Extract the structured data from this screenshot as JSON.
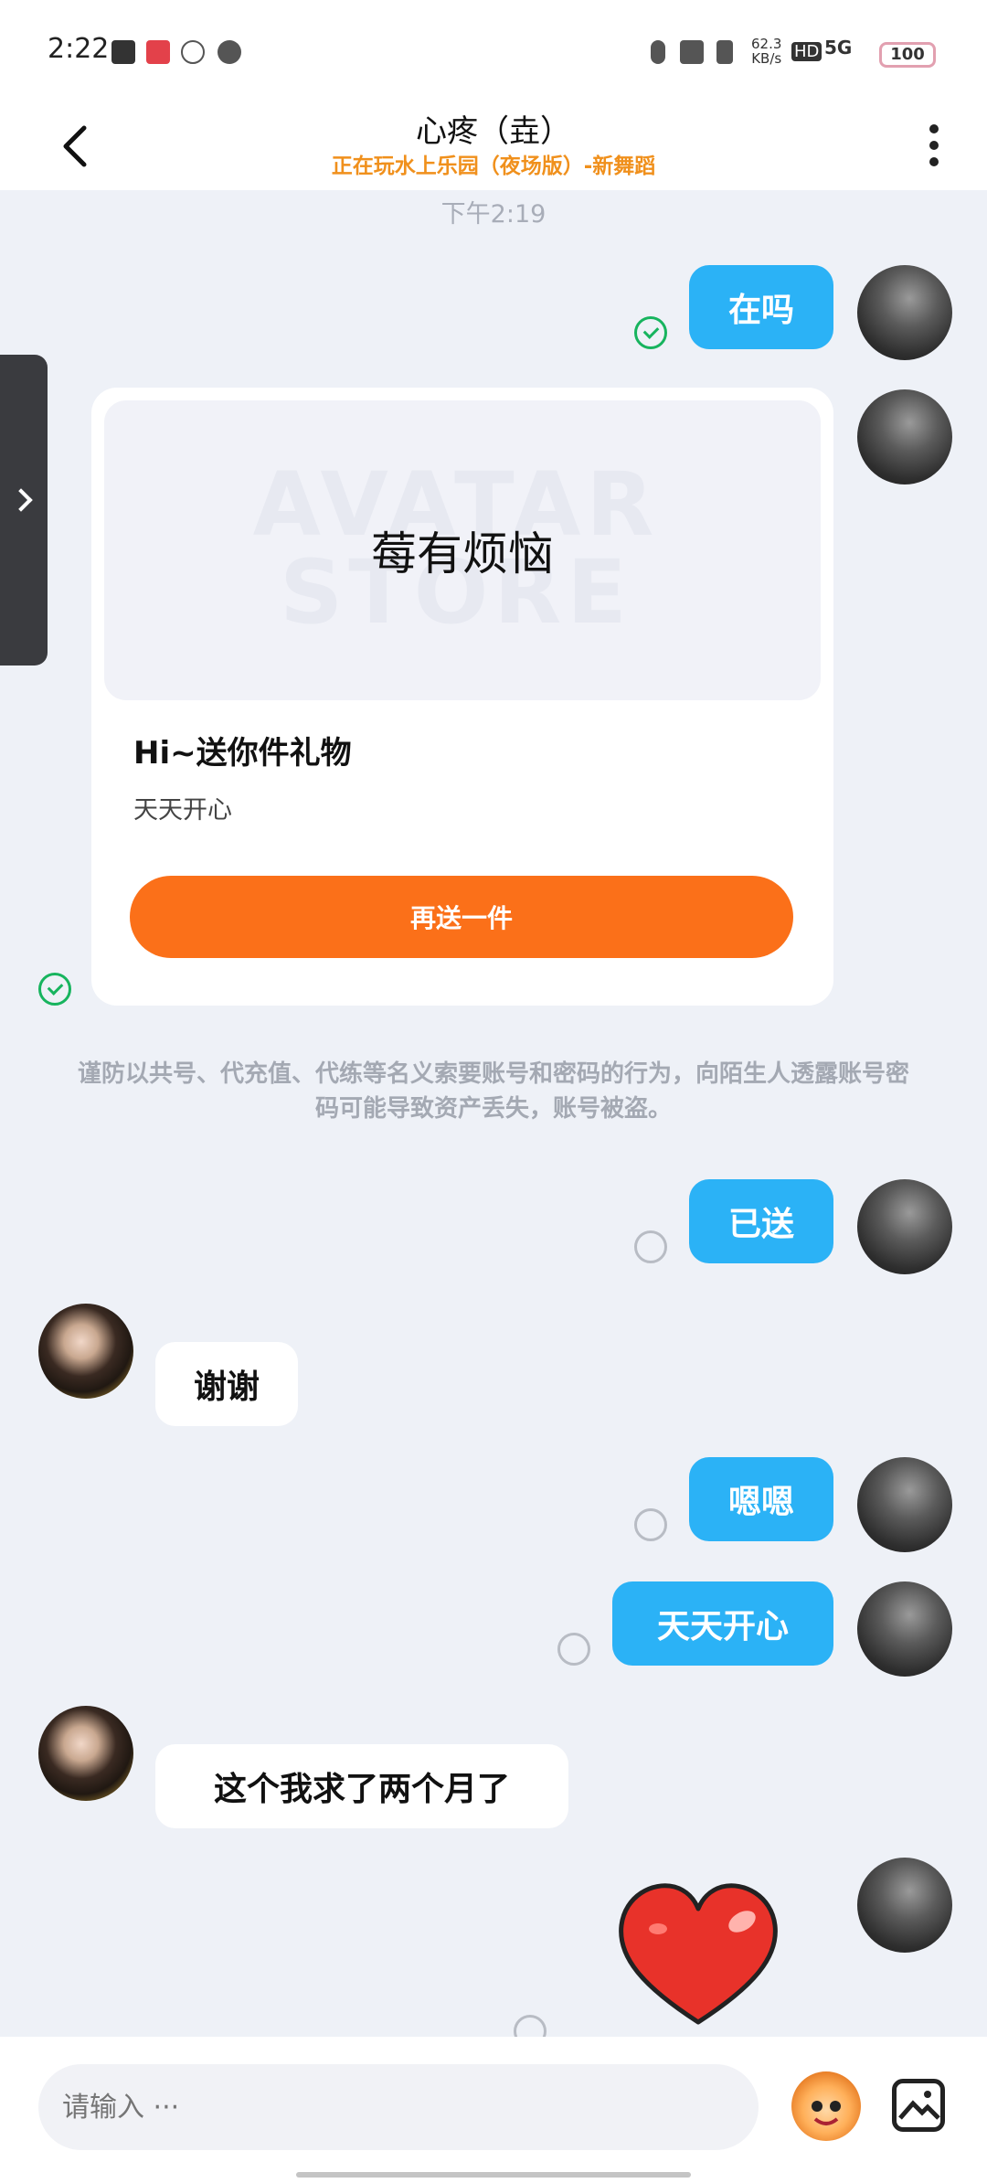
{
  "status_bar": {
    "time": "2:22",
    "speed": "62.3",
    "speed_unit": "KB/s",
    "network": "5G",
    "hd": "HD",
    "battery": "100"
  },
  "header": {
    "title": "心疼（垚）",
    "subtitle": "正在玩水上乐园（夜场版）-新舞蹈"
  },
  "chat": {
    "timestamp": "下午2:19",
    "messages": [
      {
        "from": "me",
        "text": "在吗",
        "status": "read"
      },
      {
        "from": "me",
        "type": "gift",
        "status": "read"
      },
      {
        "from": "me",
        "text": "已送",
        "status": "pending"
      },
      {
        "from": "her",
        "text": "谢谢"
      },
      {
        "from": "me",
        "text": "嗯嗯",
        "status": "pending"
      },
      {
        "from": "me",
        "text": "天天开心",
        "status": "pending"
      },
      {
        "from": "her",
        "text": "这个我求了两个月了"
      },
      {
        "from": "me",
        "type": "sticker",
        "sticker": "heart-sticker",
        "status": "pending"
      }
    ]
  },
  "gift_card": {
    "watermark": "AVATAR STORE",
    "item_name": "莓有烦恼",
    "title": "Hi~送你件礼物",
    "message": "天天开心",
    "button": "再送一件"
  },
  "notice": "谨防以共号、代充值、代练等名义索要账号和密码的行为，向陌生人透露账号密码可能导致资产丢失，账号被盗。",
  "input": {
    "placeholder": "请输入 ···"
  },
  "colors": {
    "my_bubble": "#2bb2f6",
    "gift_button": "#fb7019",
    "subtitle": "#f0901c",
    "read_check": "#17b45e"
  }
}
